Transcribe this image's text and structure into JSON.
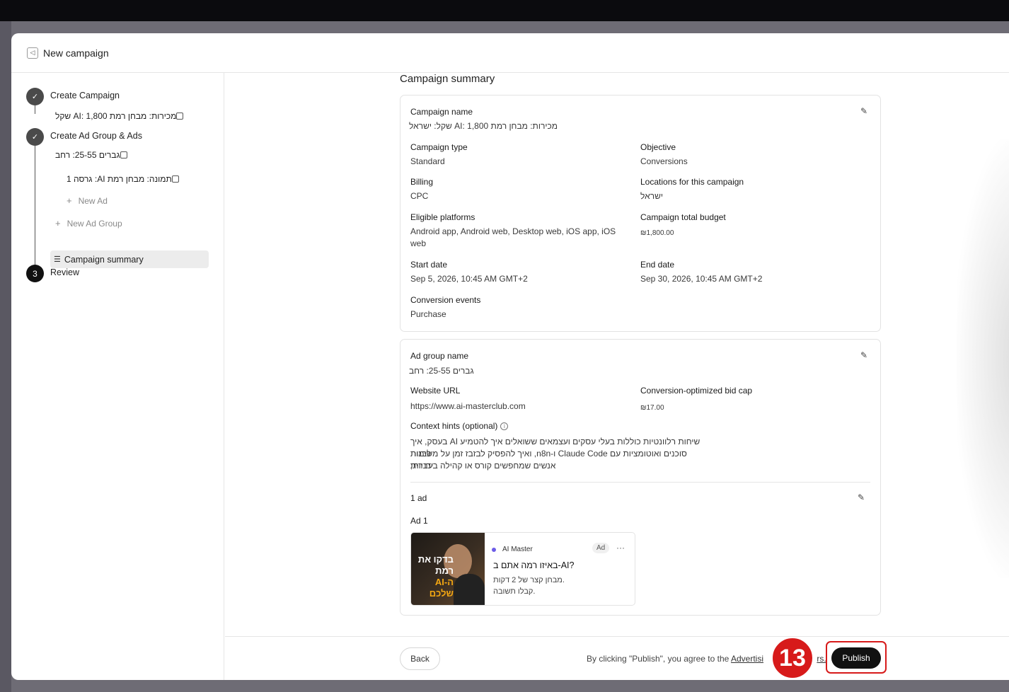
{
  "window": {
    "title": "New campaign"
  },
  "sidebar": {
    "steps": [
      {
        "label": "Create Campaign",
        "marker": "✓"
      },
      {
        "label": "Create Ad Group & Ads",
        "marker": "✓"
      },
      {
        "label": "Review",
        "marker": "3"
      }
    ],
    "campaign_item": "מכירות: מבחן רמת AI: 1,800 שקל",
    "ad_group_item": "גברים 25-55: רחב",
    "ad_item": "תמונה: מבחן רמת AI: גרסה 1",
    "new_ad": "New Ad",
    "new_ad_group": "New Ad Group",
    "active_item": "Campaign summary"
  },
  "summary": {
    "title": "Campaign summary",
    "campaign": {
      "name_label": "Campaign name",
      "name_value": "מכירות: מבחן רמת AI: 1,800 שקל: ישראל",
      "type_label": "Campaign type",
      "type_value": "Standard",
      "objective_label": "Objective",
      "objective_value": "Conversions",
      "billing_label": "Billing",
      "billing_value": "CPC",
      "locations_label": "Locations for this campaign",
      "locations_value": "ישראל",
      "platforms_label": "Eligible platforms",
      "platforms_value": "Android app, Android web, Desktop web, iOS app, iOS web",
      "budget_label": "Campaign total budget",
      "budget_value": "₪1,800.00",
      "start_label": "Start date",
      "start_value": "Sep 5, 2026, 10:45 AM GMT+2",
      "end_label": "End date",
      "end_value": "Sep 30, 2026, 10:45 AM GMT+2",
      "conversion_label": "Conversion events",
      "conversion_value": "Purchase"
    },
    "ad_group": {
      "name_label": "Ad group name",
      "name_value": "גברים 25-55: רחב",
      "url_label": "Website URL",
      "url_value": "https://www.ai-masterclub.com",
      "bid_label": "Conversion-optimized bid cap",
      "bid_value": "₪17.00",
      "hints_label": "Context hints (optional)",
      "hints_line1": "שיחות רלוונטיות כוללות בעלי עסקים ועצמאים ששואלים איך להטמיע AI בעסק, איך לבנות",
      "hints_line2": "סוכנים ואוטומציות עם Claude Code ו-n8n, ואיך להפסיק לבזבז זמן על משימות ידניות;",
      "hints_line3": "אנשים שמחפשים קורס או קהילה בעברית",
      "ads_count": "1 ad",
      "ad_label": "Ad 1",
      "ad": {
        "image_text_line1": "בדקו את רמת",
        "image_text_line2": "ה-AI שלכם",
        "brand": "AI Master",
        "tag": "Ad",
        "more": "···",
        "headline": "באיזו רמה אתם ב-AI?",
        "desc_line1": "מבחן קצר של 2 דקות.",
        "desc_line2": "קבלו תשובה."
      }
    }
  },
  "footer": {
    "back": "Back",
    "agree_prefix": "By clicking \"Publish\", you agree to the",
    "agree_link": "Advertisi",
    "agree_suffix": "rs.",
    "publish": "Publish",
    "step_badge": "13"
  },
  "icons": {
    "header": "megaphone-icon",
    "edit": "pencil-icon",
    "check": "check-icon",
    "info": "info-icon",
    "list": "list-icon"
  },
  "colors": {
    "accent": "#111111",
    "highlight": "#d71a1a"
  }
}
